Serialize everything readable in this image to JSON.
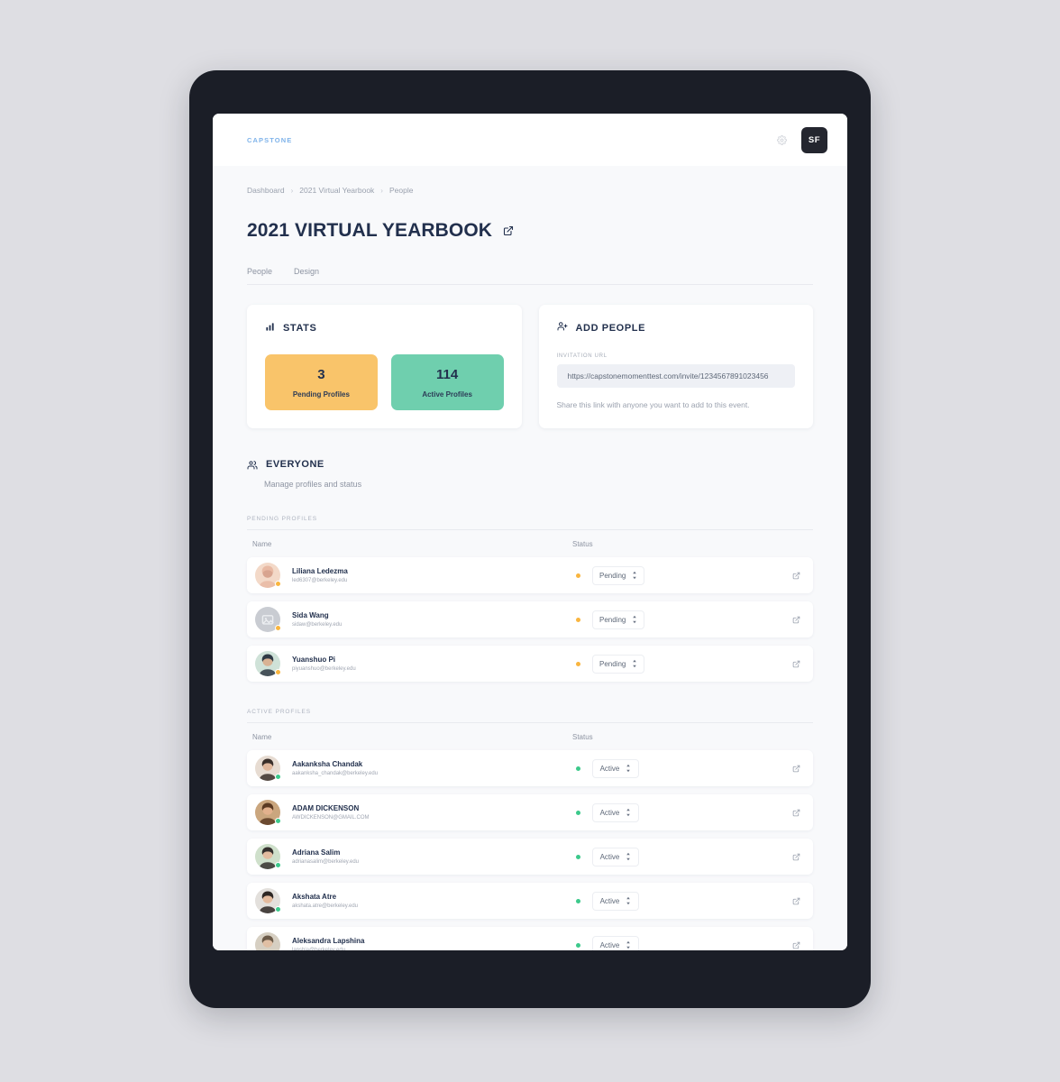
{
  "topbar": {
    "logo": "CAPSTONE",
    "settings_icon": "gear-icon",
    "avatar_initials": "SF"
  },
  "breadcrumb": {
    "items": [
      "Dashboard",
      "2021 Virtual Yearbook",
      "People"
    ],
    "separator": "›"
  },
  "page": {
    "title": "2021 VIRTUAL YEARBOOK",
    "title_link_icon": "external-link-icon"
  },
  "tabs": [
    {
      "label": "People"
    },
    {
      "label": "Design"
    }
  ],
  "stats_card": {
    "icon": "bar-chart-icon",
    "title": "STATS",
    "tiles": [
      {
        "value": "3",
        "label": "Pending Profiles",
        "color": "#f9c46a"
      },
      {
        "value": "114",
        "label": "Active Profiles",
        "color": "#6fcfae"
      }
    ]
  },
  "add_people_card": {
    "icon": "add-person-icon",
    "title": "ADD PEOPLE",
    "field_label": "INVITATION URL",
    "url_value": "https://capstonemomenttest.com/invite/1234567891023456",
    "url_placeholder": "Invitation URL",
    "hint": "Share this link with anyone you want to add to this event."
  },
  "everyone": {
    "icon": "people-icon",
    "title": "EVERYONE",
    "subtitle": "Manage profiles and status"
  },
  "groups": [
    {
      "label": "PENDING PROFILES",
      "columns": {
        "name": "Name",
        "status": "Status"
      },
      "rows": [
        {
          "name": "Liliana Ledezma",
          "email": "led6307@berkeley.edu",
          "status": "Pending",
          "state": "pending",
          "avatar": "photo-woman",
          "link_icon": "external-link-icon"
        },
        {
          "name": "Sida Wang",
          "email": "sidaw@berkeley.edu",
          "status": "Pending",
          "state": "pending",
          "avatar": "placeholder-image",
          "link_icon": "external-link-icon"
        },
        {
          "name": "Yuanshuo Pi",
          "email": "piyuanshuo@berkeley.edu",
          "status": "Pending",
          "state": "pending",
          "avatar": "photo-man-cap",
          "link_icon": "external-link-icon"
        }
      ]
    },
    {
      "label": "ACTIVE PROFILES",
      "columns": {
        "name": "Name",
        "status": "Status"
      },
      "rows": [
        {
          "name": "Aakanksha Chandak",
          "email": "aakanksha_chandak@berkeley.edu",
          "status": "Active",
          "state": "active",
          "avatar": "photo-woman-glasses",
          "link_icon": "external-link-icon"
        },
        {
          "name": "ADAM DICKENSON",
          "email": "AWDICKENSON@GMAIL.COM",
          "status": "Active",
          "state": "active",
          "avatar": "photo-man-beard",
          "link_icon": "external-link-icon"
        },
        {
          "name": "Adriana Salim",
          "email": "adrianasalim@berkeley.edu",
          "status": "Active",
          "state": "active",
          "avatar": "photo-woman-outdoor",
          "link_icon": "external-link-icon"
        },
        {
          "name": "Akshata Atre",
          "email": "akshata.atre@berkeley.edu",
          "status": "Active",
          "state": "active",
          "avatar": "photo-woman-dark",
          "link_icon": "external-link-icon"
        },
        {
          "name": "Aleksandra Lapshina",
          "email": "lapshia@berkeley.edu",
          "status": "Active",
          "state": "active",
          "avatar": "photo-group",
          "link_icon": "external-link-icon"
        }
      ]
    }
  ],
  "colors": {
    "frame": "#1b1e27",
    "page_bg": "#dedee3",
    "content_bg": "#f8f9fb",
    "title": "#22304d",
    "accent_blue": "#7fb3ea",
    "pending": "#f9b53f",
    "active": "#3cc98b"
  }
}
